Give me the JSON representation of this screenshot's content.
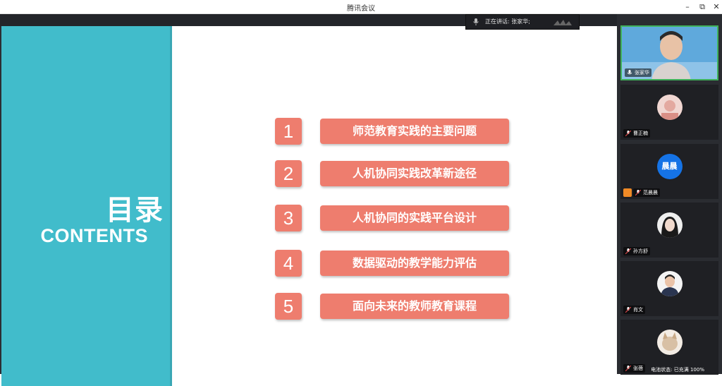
{
  "window": {
    "title": "腾讯会议",
    "minimize": "–",
    "maximize": "⧉",
    "close": "✕"
  },
  "speaking": {
    "label": "正在讲话: 张家华;"
  },
  "slide": {
    "title_cn": "目录",
    "title_en": "CONTENTS",
    "items": [
      {
        "num": "1",
        "label": "师范教育实践的主要问题"
      },
      {
        "num": "2",
        "label": "人机协同实践改革新途径"
      },
      {
        "num": "3",
        "label": "人机协同的实践平台设计"
      },
      {
        "num": "4",
        "label": "数据驱动的教学能力评估"
      },
      {
        "num": "5",
        "label": "面向未来的教师教育课程"
      }
    ],
    "colors": {
      "teal": "#41bccb",
      "coral": "#ee7d6e"
    }
  },
  "participants": [
    {
      "name": "张家华",
      "avatar": "video"
    },
    {
      "name": "曹正楠",
      "avatar": "photo"
    },
    {
      "name": "范晨晨",
      "avatar": "晨晨"
    },
    {
      "name": "孙方舒",
      "avatar": "photo"
    },
    {
      "name": "肖文",
      "avatar": "photo"
    },
    {
      "name": "张蓓",
      "avatar": "photo"
    }
  ],
  "status": {
    "battery": "电池状态: 已充满 100%"
  }
}
